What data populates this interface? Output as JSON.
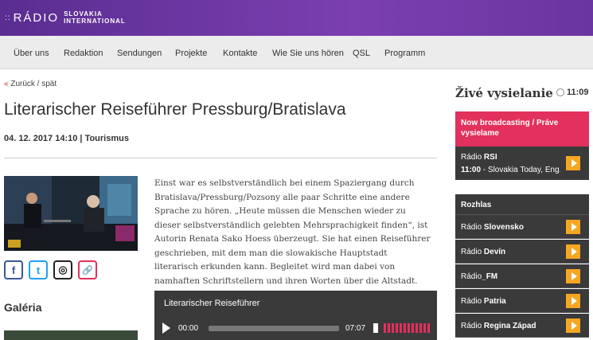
{
  "header": {
    "logo_dots": "::",
    "logo_radio": "RÁDIO",
    "logo_line1": "SLOVAKIA",
    "logo_line2": "INTERNATIONAL"
  },
  "nav": {
    "items": [
      "Über uns",
      "Redaktion",
      "Sendungen",
      "Projekte",
      "Kontakte",
      "Wie Sie uns hören",
      "QSL",
      "Programm"
    ]
  },
  "back": {
    "arrow": "«",
    "label": "Zurück / spät"
  },
  "article": {
    "title": "Literarischer Reiseführer Pressburg/Bratislava",
    "date": "04. 12. 2017 14:10",
    "separator": "|",
    "category": "Tourismus",
    "body": "Einst war es selbstverständlich bei einem Spaziergang durch Bratislava/Pressburg/Pozsony alle paar Schritte eine andere Sprache zu hören. „Heute müssen die Menschen wieder zu dieser selbstverständlich gelebten Mehrsprachigkeit finden“, ist Autorin Renata Sako Hoess überzeugt. Sie hat einen Reiseführer geschrieben, mit dem man die slowakische Hauptstadt literarisch erkunden kann. Begleitet wird man dabei von namhaften Schriftstellern und ihren Worten über die Altstadt."
  },
  "social": {
    "icons": [
      "facebook-icon",
      "twitter-icon",
      "instagram-icon",
      "link-icon"
    ],
    "glyphs": [
      "f",
      "t",
      "◎",
      "🔗"
    ],
    "colors": [
      "#3b5998",
      "#1da1f2",
      "#222222",
      "#e2315c"
    ]
  },
  "gallery": {
    "title": "Galéria"
  },
  "player": {
    "title": "Literarischer Reiseführer",
    "current_time": "00:00",
    "duration": "07:07",
    "progress": 0
  },
  "sidebar": {
    "live_title": "Živé vysielanie",
    "clock_time": "11:09",
    "now_broadcasting": "Now broadcasting / Práve vysielame",
    "now_station_prefix": "Rádio",
    "now_station": "RSI",
    "now_time": "11:00",
    "now_show": " - Slovakia Today, Eng...",
    "rozhlas_title": "Rozhlas",
    "stations": [
      {
        "prefix": "Rádio",
        "name": "Slovensko"
      },
      {
        "prefix": "Rádio",
        "name": "Devín"
      },
      {
        "prefix": "Rádio",
        "name": "_FM"
      },
      {
        "prefix": "Rádio",
        "name": "Patria"
      },
      {
        "prefix": "Rádio",
        "name": "Regina Západ"
      }
    ]
  },
  "colors": {
    "header": "#6a35a0",
    "accent": "#e2315c",
    "play": "#f5a623",
    "dark": "#3a3a3a"
  }
}
